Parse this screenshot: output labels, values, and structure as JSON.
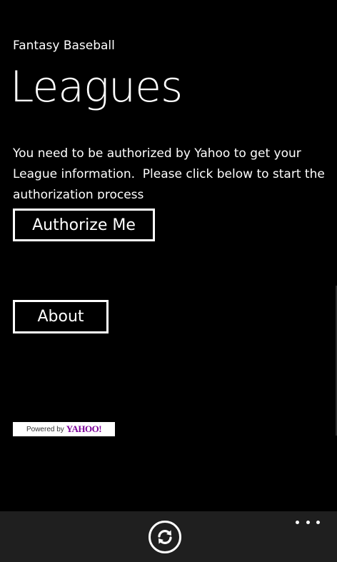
{
  "app": {
    "title": "Fantasy Baseball"
  },
  "page": {
    "title": "Leagues",
    "message": "You need to be authorized by Yahoo to get your\nLeague information.  Please click below to start the\nauthorization process"
  },
  "buttons": {
    "authorize_label": "Authorize Me",
    "about_label": "About"
  },
  "badge": {
    "powered_by": "Powered by",
    "brand": "YAHOO!"
  },
  "app_bar": {
    "refresh_icon": "refresh-icon",
    "more_icon": "ellipsis-icon"
  },
  "colors": {
    "background": "#000000",
    "foreground": "#ffffff",
    "app_bar": "#1f1f1f",
    "yahoo_purple": "#7b0099"
  }
}
